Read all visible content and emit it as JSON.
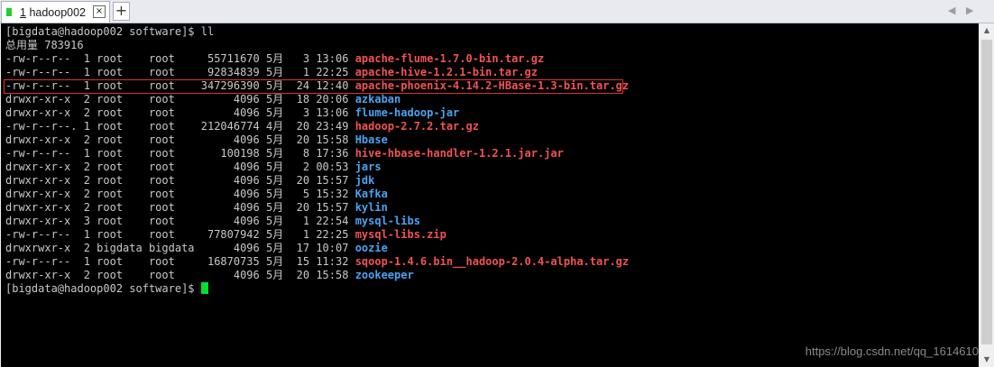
{
  "tab": {
    "number": "1",
    "title": "hadoop002",
    "close_label": "×",
    "add_label": "+"
  },
  "nav": {
    "prev": "◀",
    "next": "▶"
  },
  "terminal": {
    "prompt_line": "[bigdata@hadoop002 software]$ ll",
    "total_line": "总用量 783916",
    "rows": [
      {
        "prefix": "-rw-r--r--  1 root    root     55711670 5月   3 13:06 ",
        "name": "apache-flume-1.7.0-bin.tar.gz",
        "color": "red"
      },
      {
        "prefix": "-rw-r--r--  1 root    root     92834839 5月   1 22:25 ",
        "name": "apache-hive-1.2.1-bin.tar.gz",
        "color": "red"
      },
      {
        "prefix": "-rw-r--r--  1 root    root    347296390 5月  24 12:40 ",
        "name": "apache-phoenix-4.14.2-HBase-1.3-bin.tar.gz",
        "color": "red"
      },
      {
        "prefix": "drwxr-xr-x  2 root    root         4096 5月  18 20:06 ",
        "name": "azkaban",
        "color": "blue"
      },
      {
        "prefix": "drwxr-xr-x  2 root    root         4096 5月   3 13:06 ",
        "name": "flume-hadoop-jar",
        "color": "blue"
      },
      {
        "prefix": "-rw-r--r--. 1 root    root    212046774 4月  20 23:49 ",
        "name": "hadoop-2.7.2.tar.gz",
        "color": "red"
      },
      {
        "prefix": "drwxr-xr-x  2 root    root         4096 5月  20 15:58 ",
        "name": "Hbase",
        "color": "blue"
      },
      {
        "prefix": "-rw-r--r--  1 root    root       100198 5月   8 17:36 ",
        "name": "hive-hbase-handler-1.2.1.jar.jar",
        "color": "red"
      },
      {
        "prefix": "drwxr-xr-x  2 root    root         4096 5月   2 00:53 ",
        "name": "jars",
        "color": "blue"
      },
      {
        "prefix": "drwxr-xr-x  2 root    root         4096 5月  20 15:57 ",
        "name": "jdk",
        "color": "blue"
      },
      {
        "prefix": "drwxr-xr-x  2 root    root         4096 5月   5 15:32 ",
        "name": "Kafka",
        "color": "blue"
      },
      {
        "prefix": "drwxr-xr-x  2 root    root         4096 5月  20 15:57 ",
        "name": "kylin",
        "color": "blue"
      },
      {
        "prefix": "drwxr-xr-x  3 root    root         4096 5月   1 22:54 ",
        "name": "mysql-libs",
        "color": "blue"
      },
      {
        "prefix": "-rw-r--r--  1 root    root     77807942 5月   1 22:25 ",
        "name": "mysql-libs.zip",
        "color": "red"
      },
      {
        "prefix": "drwxrwxr-x  2 bigdata bigdata      4096 5月  17 10:07 ",
        "name": "oozie",
        "color": "blue"
      },
      {
        "prefix": "-rw-r--r--  1 root    root     16870735 5月  15 11:32 ",
        "name": "sqoop-1.4.6.bin__hadoop-2.0.4-alpha.tar.gz",
        "color": "red"
      },
      {
        "prefix": "drwxr-xr-x  2 root    root         4096 5月  20 15:58 ",
        "name": "zookeeper",
        "color": "blue"
      }
    ],
    "final_prompt": "[bigdata@hadoop002 software]$ ",
    "watermark": "https://blog.csdn.net/qq_1614610"
  },
  "colors": {
    "file_red": "#f05353",
    "dir_blue": "#4aa3f0",
    "text": "#c9c9c9",
    "cursor": "#00e02c",
    "highlight_border": "#d9342b"
  },
  "scroll": {
    "up": "▲",
    "down": "▼"
  }
}
